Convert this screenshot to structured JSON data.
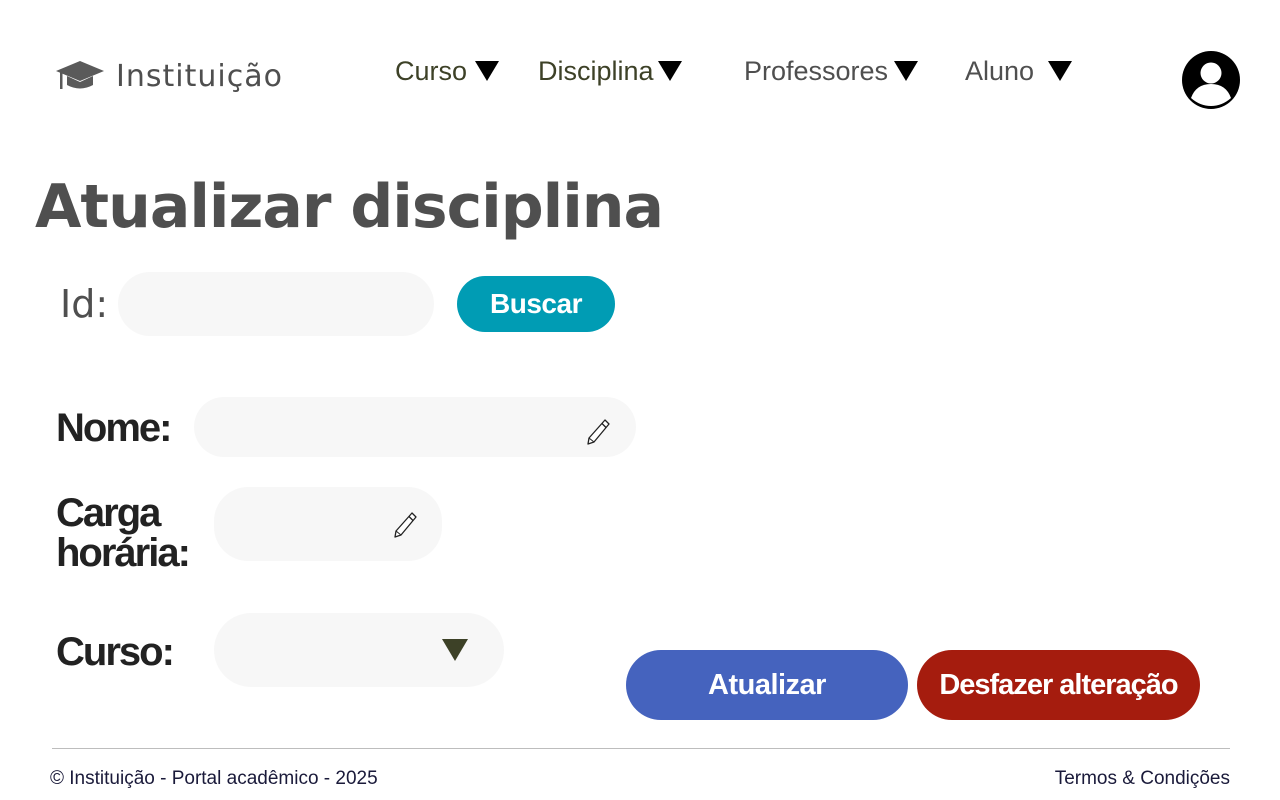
{
  "header": {
    "brand": "Instituição",
    "logo_icon": "graduation-cap-icon",
    "nav": [
      {
        "label": "Curso",
        "icon": "caret-down-icon"
      },
      {
        "label": "Disciplina",
        "icon": "caret-down-icon"
      },
      {
        "label": "Professores",
        "icon": "caret-down-icon"
      },
      {
        "label": "Aluno",
        "icon": "caret-down-icon"
      }
    ],
    "avatar_icon": "user-avatar-icon"
  },
  "main": {
    "title": "Atualizar disciplina",
    "id_label": "Id:",
    "id_value": "",
    "search_button": "Buscar",
    "fields": {
      "nome_label": "Nome:",
      "nome_value": "",
      "carga_label_line1": "Carga",
      "carga_label_line2": "horária:",
      "carga_value": "",
      "curso_label": "Curso:",
      "curso_selected": ""
    },
    "edit_icon": "pencil-icon",
    "update_button": "Atualizar",
    "undo_button": "Desfazer alteração"
  },
  "footer": {
    "copyright": "© Instituição - Portal acadêmico - 2025",
    "terms": "Termos & Condições"
  },
  "colors": {
    "search_button": "#009cb4",
    "update_button": "#4563be",
    "undo_button": "#a51c0e",
    "nav_accent": "#3d4127",
    "input_bg": "#f7f7f7"
  }
}
